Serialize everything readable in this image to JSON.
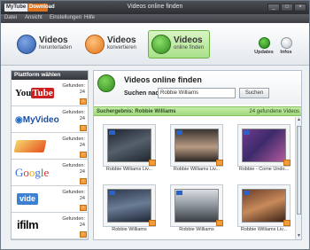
{
  "window": {
    "title": "Videos online finden",
    "logo_left": "MyTube",
    "logo_right": "Download",
    "buttons": [
      "_",
      "□",
      "×"
    ]
  },
  "menu": [
    "Datei",
    "Ansicht",
    "Einstellungen",
    "Hilfe"
  ],
  "toolbar": {
    "download": {
      "label": "Videos",
      "sub": "herunterladen"
    },
    "convert": {
      "label": "Videos",
      "sub": "konvertieren"
    },
    "find": {
      "label": "Videos",
      "sub": "online finden"
    },
    "updates": "Updates",
    "info": "Infos"
  },
  "platforms": {
    "header": "Plattform wählen",
    "found_label": "Gefunden:",
    "items": [
      {
        "name": "YouTube",
        "count": "24"
      },
      {
        "name": "MyVideo",
        "count": "24"
      },
      {
        "name": "Clipfish",
        "count": "24"
      },
      {
        "name": "Google",
        "count": "24"
      },
      {
        "name": "vide",
        "count": "24"
      },
      {
        "name": "ifilm",
        "count": "24"
      }
    ]
  },
  "search": {
    "title": "Videos online finden",
    "label": "Suchen nach:",
    "value": "Robbie Williams",
    "button": "Suchen"
  },
  "results": {
    "left": "Suchergebnis: Robbie Williams",
    "right": "24 gefundene Videos",
    "videos": [
      {
        "caption": "Robbie Williams Liv..."
      },
      {
        "caption": "Robbie Williams Liv..."
      },
      {
        "caption": "Robbie - Come Undo..."
      },
      {
        "caption": "Robbie Williams"
      },
      {
        "caption": "Robbie Williams"
      },
      {
        "caption": "Robbie Williams Liv..."
      }
    ]
  },
  "colors": {
    "accent_green": "#6cb544",
    "orange": "#f29b3a",
    "dark": "#33363b"
  }
}
